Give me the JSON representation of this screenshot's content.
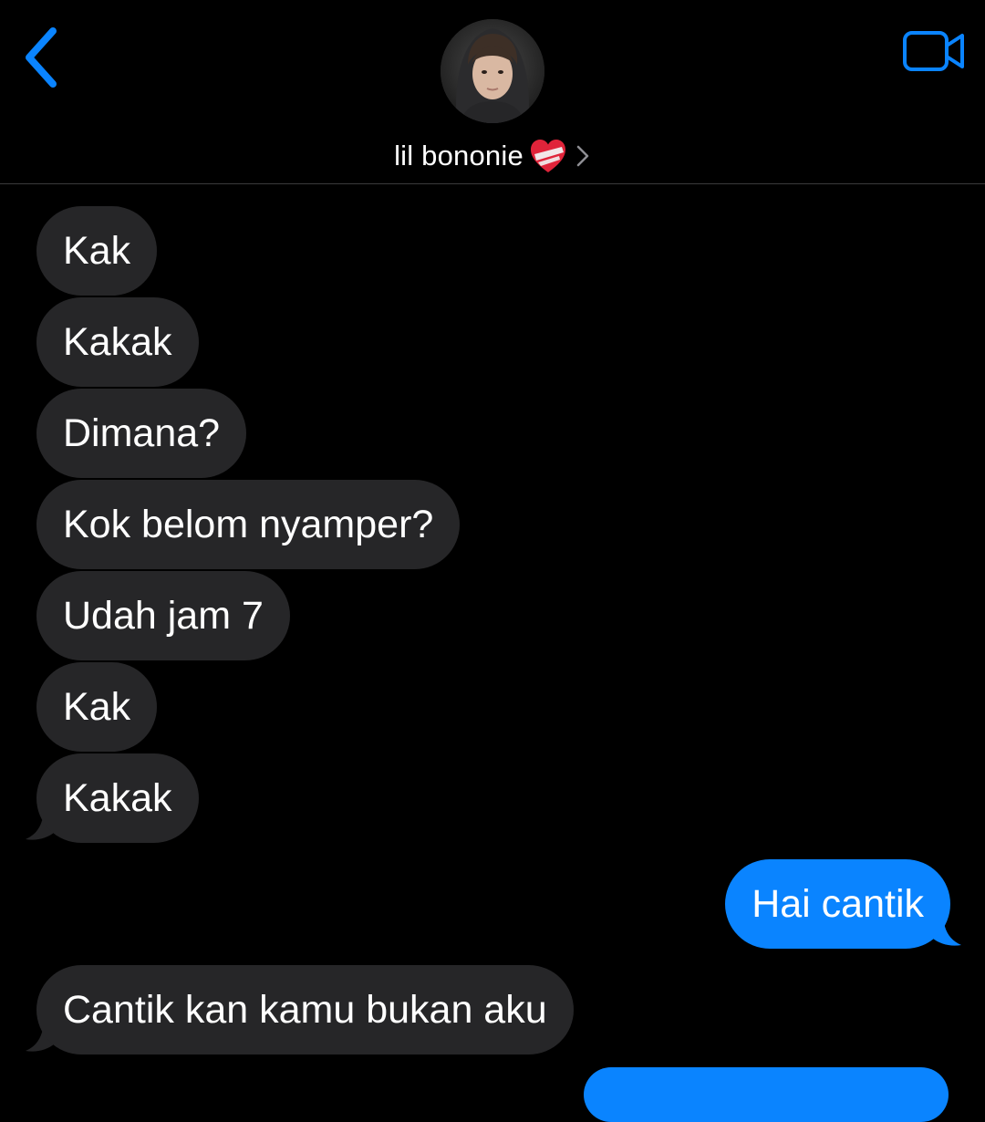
{
  "header": {
    "contact_name": "lil bononie",
    "back_icon": "chevron-left-icon",
    "video_icon": "video-camera-icon",
    "heart_icon": "mending-heart-icon",
    "accent_color": "#0a84ff"
  },
  "messages": [
    {
      "sender": "them",
      "text": "Kak"
    },
    {
      "sender": "them",
      "text": "Kakak"
    },
    {
      "sender": "them",
      "text": "Dimana?"
    },
    {
      "sender": "them",
      "text": "Kok belom nyamper?"
    },
    {
      "sender": "them",
      "text": "Udah jam 7"
    },
    {
      "sender": "them",
      "text": "Kak"
    },
    {
      "sender": "them",
      "text": "Kakak"
    },
    {
      "sender": "me",
      "text": "Hai cantik"
    },
    {
      "sender": "them",
      "text": "Cantik kan kamu bukan aku"
    }
  ],
  "colors": {
    "received_bubble": "#262628",
    "sent_bubble": "#0a84ff",
    "background": "#000000"
  }
}
